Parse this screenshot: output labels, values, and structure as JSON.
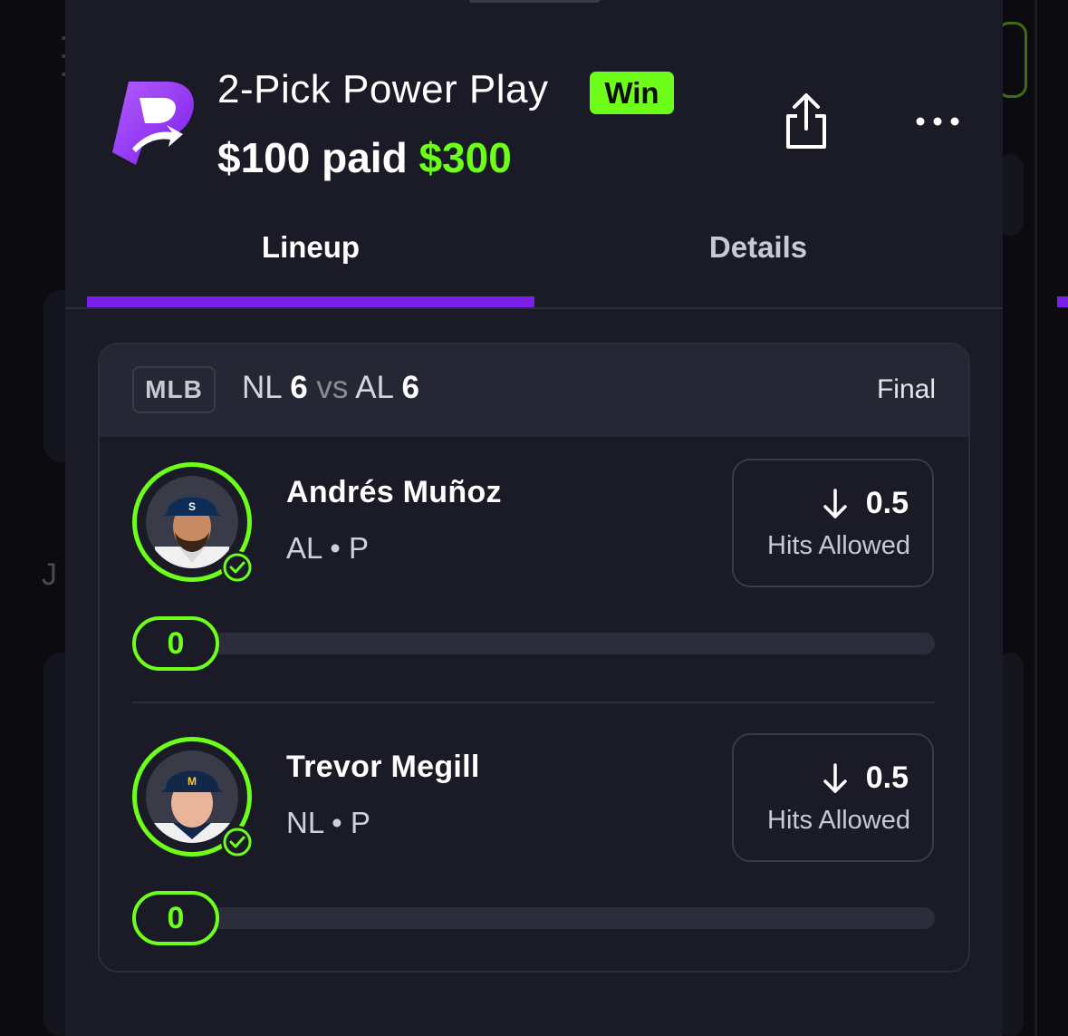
{
  "entry": {
    "title": "2-Pick Power Play",
    "result_badge": "Win",
    "paid_label": "$100 paid",
    "payout": "$300"
  },
  "tabs": [
    {
      "label": "Lineup",
      "active": true
    },
    {
      "label": "Details",
      "active": false
    }
  ],
  "game": {
    "league": "MLB",
    "team_a": "NL",
    "score_a": "6",
    "vs": "vs",
    "team_b": "AL",
    "score_b": "6",
    "status": "Final"
  },
  "picks": [
    {
      "name": "Andrés Muñoz",
      "meta": "AL • P",
      "line": "0.5",
      "direction": "under",
      "stat": "Hits Allowed",
      "current": "0",
      "progress": 0,
      "cap_color": "#0c2c56",
      "cap_logo": "S"
    },
    {
      "name": "Trevor Megill",
      "meta": "NL • P",
      "line": "0.5",
      "direction": "under",
      "stat": "Hits Allowed",
      "current": "0",
      "progress": 0,
      "cap_color": "#12284b",
      "cap_logo": "M"
    }
  ],
  "colors": {
    "accent_green": "#6dff1a",
    "accent_purple": "#7a1fe8",
    "sheet_bg": "#1a1b26"
  },
  "icons": {
    "logo": "prizepicks-logo",
    "share": "share-icon",
    "more": "more-horizontal-icon",
    "direction": "arrow-down-icon",
    "check": "check-circle-icon"
  }
}
